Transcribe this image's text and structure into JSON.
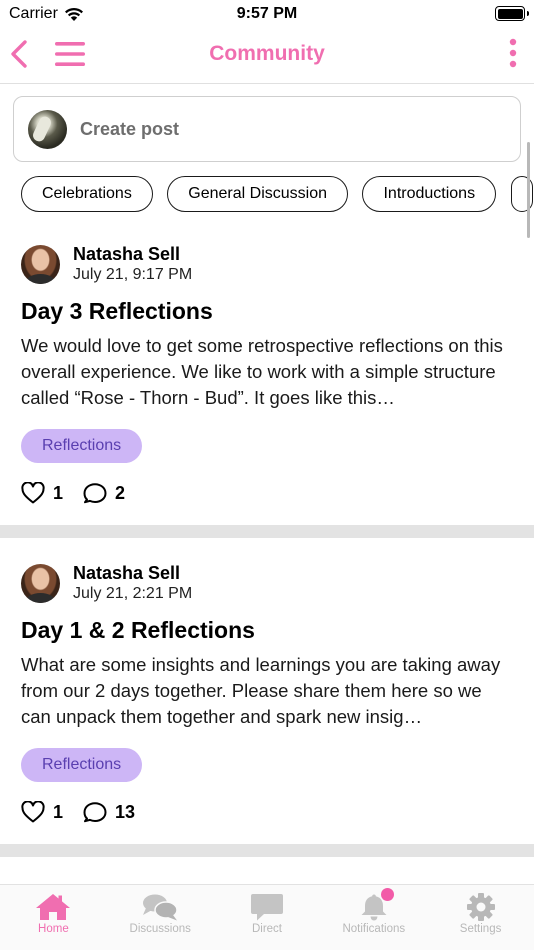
{
  "status_bar": {
    "carrier": "Carrier",
    "time": "9:57 PM"
  },
  "nav": {
    "title": "Community",
    "icons": [
      "back-chevron-icon",
      "hamburger-menu-icon",
      "more-vertical-icon"
    ]
  },
  "create_post": {
    "label": "Create post"
  },
  "categories": [
    "Celebrations",
    "General Discussion",
    "Introductions"
  ],
  "posts": [
    {
      "author": "Natasha Sell",
      "date": "July 21, 9:17 PM",
      "title": "Day 3 Reflections",
      "body": "We would love to get some retrospective reflections on this overall experience.  We like to work with a simple structure called “Rose - Thorn - Bud”.  It goes like this…",
      "tag": "Reflections",
      "likes": "1",
      "comments": "2"
    },
    {
      "author": "Natasha Sell",
      "date": "July 21, 2:21 PM",
      "title": "Day 1 & 2 Reflections",
      "body": "What are some insights and learnings you are taking away from our 2 days together. Please share them here so we can unpack them together and spark new insig…",
      "tag": "Reflections",
      "likes": "1",
      "comments": "13"
    }
  ],
  "tabs": [
    {
      "label": "Home",
      "icon": "home-icon",
      "active": true
    },
    {
      "label": "Discussions",
      "icon": "discussions-icon",
      "active": false
    },
    {
      "label": "Direct",
      "icon": "direct-message-icon",
      "active": false
    },
    {
      "label": "Notifications",
      "icon": "bell-icon",
      "active": false
    },
    {
      "label": "Settings",
      "icon": "gear-icon",
      "active": false
    }
  ],
  "colors": {
    "accent": "#f06eb0",
    "tag_bg": "#cdb6f6",
    "tag_text": "#5a3fb0",
    "inactive": "#b8b8b8"
  }
}
